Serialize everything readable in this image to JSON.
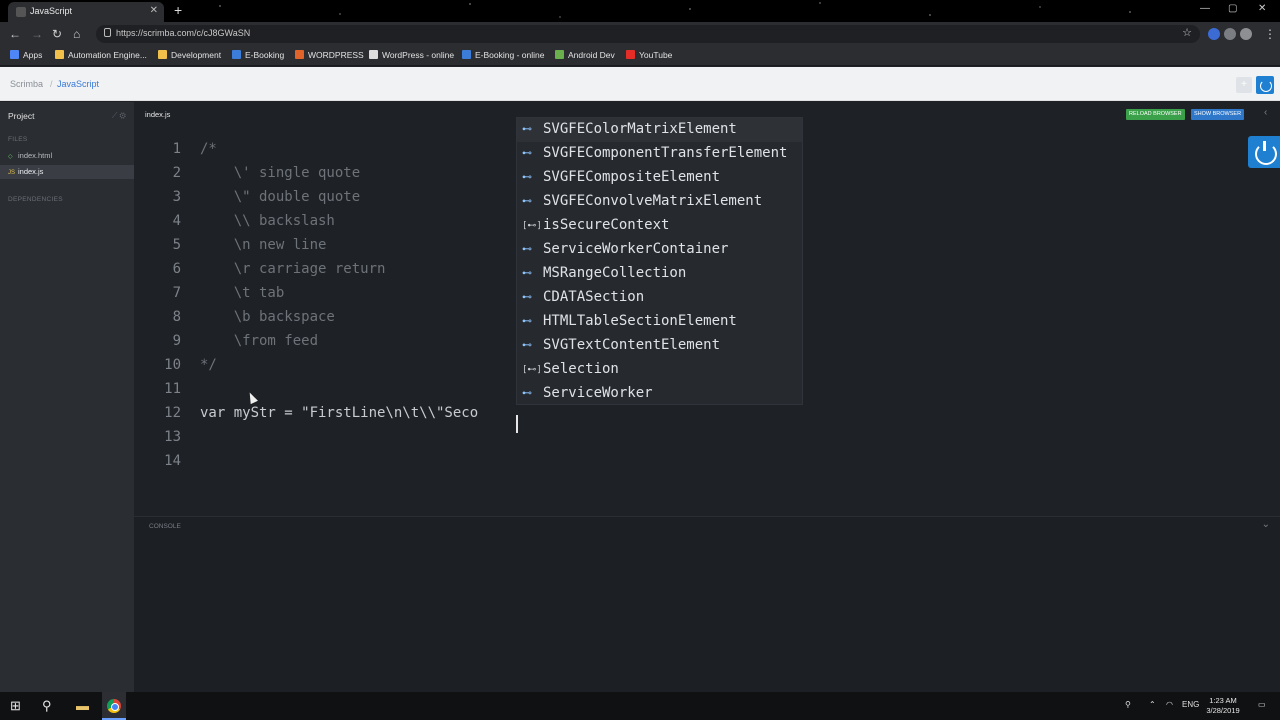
{
  "browser": {
    "tab_title": "JavaScript",
    "tab_close": "✕",
    "new_tab": "+",
    "url": "https://scrimba.com/c/cJ8GWaSN",
    "window_controls": [
      "—",
      "▢",
      "✕"
    ],
    "bookmarks": [
      {
        "label": "Apps",
        "icon": "apps-grid-icon",
        "color": "#4f86f7"
      },
      {
        "label": "Automation Engine...",
        "icon": "folder-icon",
        "color": "#f1c04b"
      },
      {
        "label": "Development",
        "icon": "folder-icon",
        "color": "#f1c04b"
      },
      {
        "label": "E-Booking",
        "icon": "site-icon",
        "color": "#3b7dd8"
      },
      {
        "label": "WORDPRESS",
        "icon": "site-icon",
        "color": "#e0632a"
      },
      {
        "label": "WordPress - online",
        "icon": "page-icon",
        "color": "#dddddd"
      },
      {
        "label": "E-Booking - online",
        "icon": "site-icon",
        "color": "#3b7dd8"
      },
      {
        "label": "Android Dev",
        "icon": "android-icon",
        "color": "#6ab04c"
      },
      {
        "label": "YouTube",
        "icon": "youtube-icon",
        "color": "#e52d27"
      }
    ]
  },
  "header": {
    "brand": "Scrimba",
    "separator": "/",
    "course": "JavaScript",
    "plus_label": "+"
  },
  "sidebar": {
    "title": "Project",
    "tools": "⟋ ⚙",
    "files_label": "FILES",
    "files": [
      {
        "name": "index.html",
        "type": "html",
        "icon": "◇"
      },
      {
        "name": "index.js",
        "type": "js",
        "icon": "JS"
      }
    ],
    "dependencies_label": "DEPENDENCIES"
  },
  "editor": {
    "tab": "index.js",
    "reload_label": "RELOAD BROWSER",
    "show_label": "SHOW BROWSER",
    "collapse": "‹",
    "lines": [
      {
        "n": "1",
        "text": "/*",
        "kind": "comment"
      },
      {
        "n": "2",
        "text": "    \\' single quote",
        "kind": "comment"
      },
      {
        "n": "3",
        "text": "    \\\" double quote",
        "kind": "comment"
      },
      {
        "n": "4",
        "text": "    \\\\ backslash",
        "kind": "comment"
      },
      {
        "n": "5",
        "text": "    \\n new line",
        "kind": "comment"
      },
      {
        "n": "6",
        "text": "    \\r carriage return",
        "kind": "comment"
      },
      {
        "n": "7",
        "text": "    \\t tab",
        "kind": "comment"
      },
      {
        "n": "8",
        "text": "    \\b backspace",
        "kind": "comment"
      },
      {
        "n": "9",
        "text": "    \\from feed",
        "kind": "comment"
      },
      {
        "n": "10",
        "text": "*/",
        "kind": "comment"
      },
      {
        "n": "11",
        "text": "",
        "kind": "code"
      },
      {
        "n": "12",
        "text": "var myStr = \"FirstLine\\n\\t\\\\\"Seco",
        "kind": "code"
      },
      {
        "n": "13",
        "text": "",
        "kind": "code"
      },
      {
        "n": "14",
        "text": "",
        "kind": "code"
      }
    ]
  },
  "autocomplete": {
    "items": [
      {
        "label": "SVGFEColorMatrixElement",
        "icon": "⊷",
        "kind": "class"
      },
      {
        "label": "SVGFEComponentTransferElement",
        "icon": "⊷",
        "kind": "class"
      },
      {
        "label": "SVGFECompositeElement",
        "icon": "⊷",
        "kind": "class"
      },
      {
        "label": "SVGFEConvolveMatrixElement",
        "icon": "⊷",
        "kind": "class"
      },
      {
        "label": "isSecureContext",
        "icon": "[⊷]",
        "kind": "variable"
      },
      {
        "label": "ServiceWorkerContainer",
        "icon": "⊷",
        "kind": "class"
      },
      {
        "label": "MSRangeCollection",
        "icon": "⊷",
        "kind": "class"
      },
      {
        "label": "CDATASection",
        "icon": "⊷",
        "kind": "class"
      },
      {
        "label": "HTMLTableSectionElement",
        "icon": "⊷",
        "kind": "class"
      },
      {
        "label": "SVGTextContentElement",
        "icon": "⊷",
        "kind": "class"
      },
      {
        "label": "Selection",
        "icon": "[⊷]",
        "kind": "variable"
      },
      {
        "label": "ServiceWorker",
        "icon": "⊷",
        "kind": "class"
      }
    ]
  },
  "console": {
    "label": "CONSOLE",
    "chevron": "⌄"
  },
  "taskbar": {
    "start": "⊞",
    "search": "⚲",
    "explorer": "▬",
    "language": "ENG",
    "time": "1:23 AM",
    "date": "3/28/2019"
  }
}
